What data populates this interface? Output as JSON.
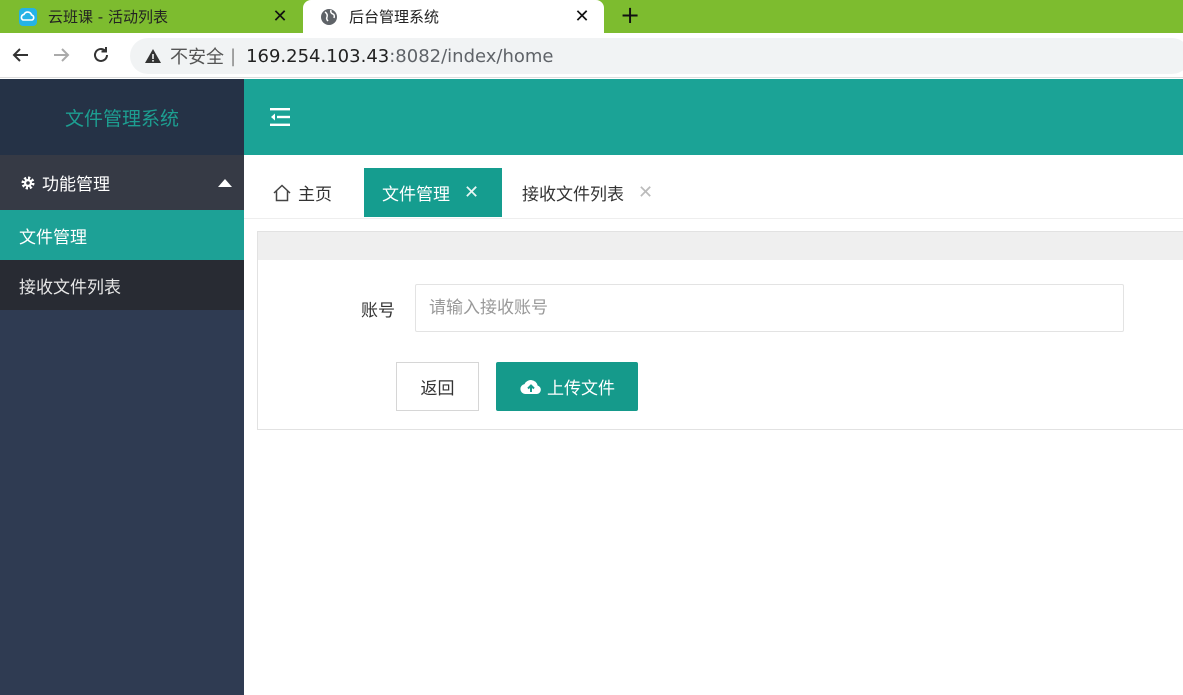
{
  "browser": {
    "tabs": [
      {
        "title": "云班课 - 活动列表",
        "active": false
      },
      {
        "title": "后台管理系统",
        "active": true
      }
    ],
    "new_tab": "+",
    "close_glyph": "✕",
    "address": {
      "security": "不安全",
      "separator": "|",
      "host": "169.254.103.43",
      "path": ":8082/index/home"
    }
  },
  "app": {
    "logo": "文件管理系统",
    "sidebar": {
      "group": {
        "label": "功能管理",
        "icon": "gear-icon",
        "expanded": true
      },
      "items": [
        {
          "label": "文件管理",
          "active": true
        },
        {
          "label": "接收文件列表",
          "active": false
        }
      ]
    },
    "tabs": [
      {
        "label": "主页",
        "icon": "home-icon",
        "closable": false
      },
      {
        "label": "文件管理",
        "closable": true,
        "active": true
      },
      {
        "label": "接收文件列表",
        "closable": true
      }
    ],
    "tab_close_glyph": "✕",
    "form": {
      "account_label": "账号",
      "account_placeholder": "请输入接收账号",
      "account_value": "",
      "back_button": "返回",
      "upload_button": "上传文件"
    },
    "colors": {
      "primary": "#1ba396",
      "sidebar_bg": "#2f3b52",
      "tab_strip": "#7dbc2f"
    }
  }
}
